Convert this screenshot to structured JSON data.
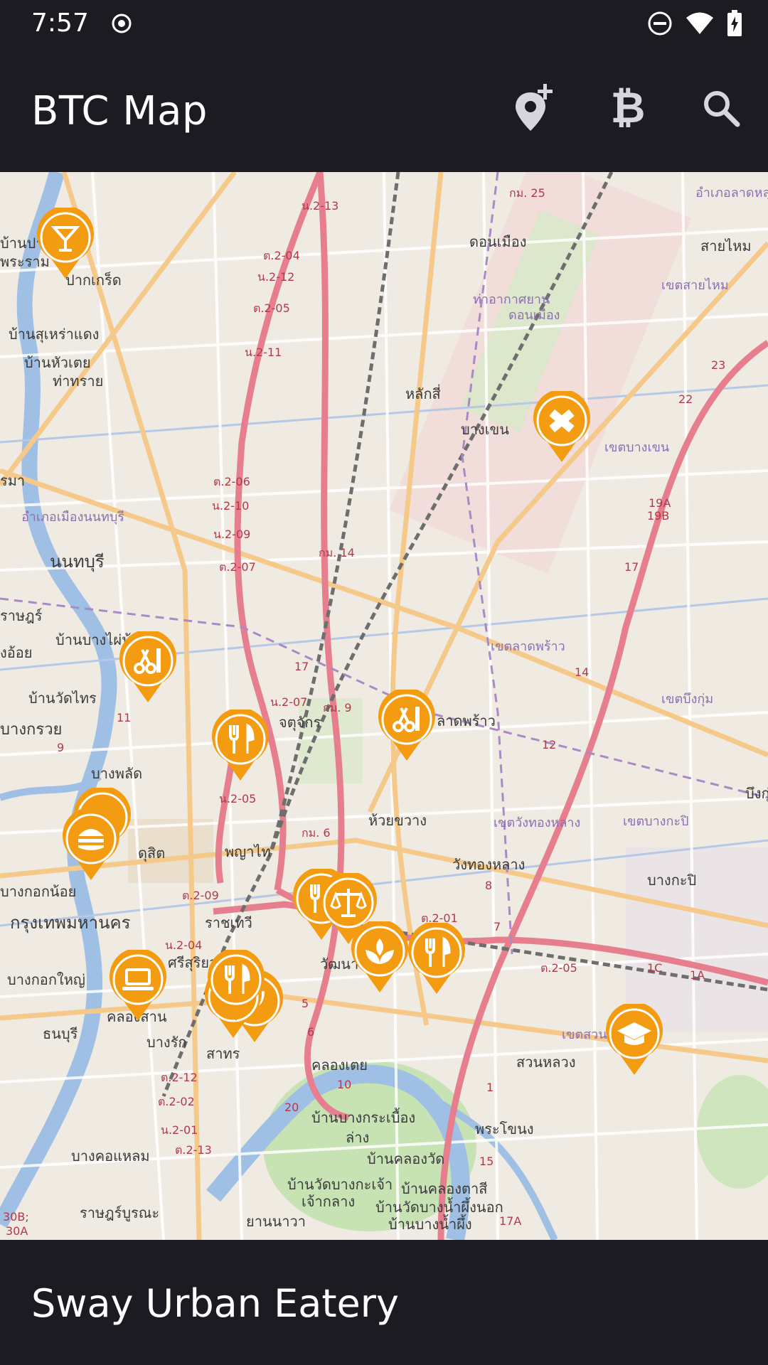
{
  "status_bar": {
    "time": "7:57",
    "icons": [
      "record-icon",
      "dnd-icon",
      "wifi-icon",
      "battery-charging-icon"
    ]
  },
  "app_bar": {
    "title": "BTC Map",
    "actions": [
      "add-location-icon",
      "bitcoin-icon",
      "search-icon"
    ],
    "bitcoin_glyph": "₿"
  },
  "map": {
    "labels": {
      "pakkret": "ปากเกร็ด",
      "don_mueang": "ดอนเมือง",
      "sai_mai": "สายไหม",
      "khet_sai_mai": "เขตสายไหม",
      "airport": "ท่าอากาศยาน",
      "airport2": "ดอนเมือง",
      "lak_si": "หลักสี่",
      "bang_khen": "บางเขน",
      "khet_bang_khen": "เขตบางเขน",
      "nonthaburi": "นนทบุรี",
      "amphoe_nonthaburi": "อำเภอเมืองนนทบุรี",
      "khet_lat_phrao": "เขตลาดพร้าว",
      "lat_phrao": "ลาดพร้าว",
      "khet_bueng_kum": "เขตบึงกุ่ม",
      "chatuchak": "จตุจักร",
      "bang_phlat": "บางพลัด",
      "huai_khwang": "ห้วยขวาง",
      "khet_wang_thonglang": "เขตวังทองหลาง",
      "khet_bang_kapi": "เขตบางกะปิ",
      "wang_thonglang": "วังทองหลาง",
      "bang_kapi": "บางกะปิ",
      "dusit": "ดุสิต",
      "phaya_thai": "พญาไท",
      "bangkok": "กรุงเทพมหานคร",
      "ratchathewi": "ราชเทวี",
      "bangkok_noi": "บางกอกน้อย",
      "bangkok_yai": "บางกอกใหญ่",
      "thonburi": "ธนบุรี",
      "bang_rak": "บางรัก",
      "sathon": "สาทร",
      "khlong_toei": "คลองเตย",
      "suan_luang": "สวนหลวง",
      "phra_khanong": "พระโขนง",
      "bang_kho_laem": "บางคอแหลม",
      "rat_burana": "ราษฎร์บูรณะ",
      "yan_nawa": "ยานนาวา",
      "ban_bang_krachao": "บ้านบางกระเบื้อง",
      "ban_khlong_wat": "บ้านคลองวัด",
      "ban_khlong_toei": "บ้านคลองตาสี",
      "ban_wat_bang_nam_phueng": "บ้านวัดบางน้ำผึ้งนอก",
      "ban_bang_nam_phueng": "บ้านบางน้ำผึ้ง",
      "ban_wat_bang_kacha": "บ้านวัดบางกะเจ้า",
      "chao_klang": "เจ้ากลาง",
      "lang": "ล่าง",
      "ban_suan_laeng": "บ้านสุเหร่าแดง",
      "ban_hua_loei": "บ้านหัวเตย",
      "tha_sai": "ท่าทราย",
      "ban_bang_phai": "บ้านบางไผ่น้อย",
      "ban_wat_krai": "บ้านวัดไทร",
      "bang_krui": "บางกรวย",
      "rat_rat": "ราษฎร์",
      "ngo_oi": "งอ้อย",
      "ban_pak": "บ้านปาก",
      "phra_ram": "พระราม",
      "khlong": "คลองสาน",
      "wattana": "วัฒนา",
      "sisuriya": "ศรีสุริยวงศ์",
      "khet_suan": "เขตสวน",
      "amphoe_lat": "อำเภอลาดหลุมแก้ว",
      "bueng": "บึงกุ่ม",
      "pha": "รมา"
    },
    "roads": {
      "r1": "น.2-13",
      "r2": "ต.2-04",
      "r3": "น.2-12",
      "r4": "ต.2-05",
      "r5": "น.2-11",
      "r6": "ต.2-06",
      "r7": "น.2-10",
      "r8": "น.2-09",
      "r9": "ต.2-07",
      "r10": "กม. 14",
      "r11": "น.2-07",
      "r12": "กม. 9",
      "r13": "น.2-05",
      "r14": "กม. 6",
      "r15": "ต.2-09",
      "r16": "น.2-04",
      "r17": "ต.2-01",
      "r18": "ต.2-05",
      "r19": "ต.2-12",
      "r20": "ต.2-02",
      "r21": "น.2-01",
      "r22": "ต.2-13",
      "r23": "กม. 25",
      "r24": "23",
      "r25": "22",
      "r26": "19A",
      "r27": "19B",
      "r28": "17",
      "r29": "14",
      "r30": "12",
      "r31": "8",
      "r32": "11",
      "r33": "9",
      "r34": "10",
      "r35": "20",
      "r36": "15",
      "r37": "17A",
      "r38": "30B;",
      "r39": "30A",
      "r40": "1C",
      "r41": "1A",
      "r42": "6",
      "r43": "5",
      "r44": "17",
      "r45": "7",
      "r46": "1"
    },
    "markers": [
      {
        "name": "cocktail-icon"
      },
      {
        "name": "drafting-icon"
      },
      {
        "name": "barber-icon"
      },
      {
        "name": "restaurant-icon"
      },
      {
        "name": "barber-icon"
      },
      {
        "name": "burger-icon"
      },
      {
        "name": "restaurant-icon"
      },
      {
        "name": "legal-icon"
      },
      {
        "name": "spa-icon"
      },
      {
        "name": "restaurant-icon"
      },
      {
        "name": "computer-icon"
      },
      {
        "name": "restaurant-icon"
      },
      {
        "name": "education-icon"
      }
    ],
    "marker_color": "#f39c12"
  },
  "fab": {
    "icon": "my-location-icon",
    "color": "#5a3598"
  },
  "bottom_sheet": {
    "place_name": "Sway Urban Eatery"
  }
}
